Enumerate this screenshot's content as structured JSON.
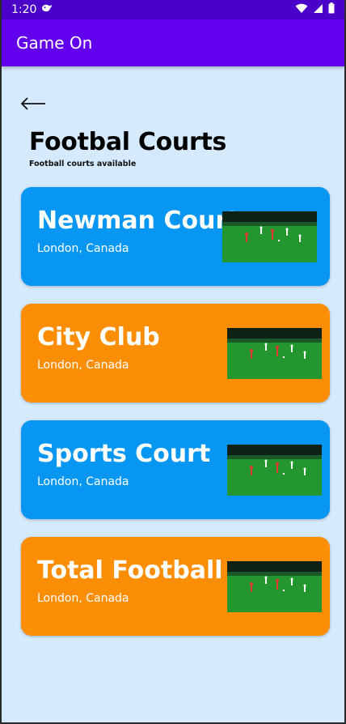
{
  "status_bar": {
    "time": "1:20"
  },
  "app_bar": {
    "title": "Game On"
  },
  "page": {
    "title": "Footbal Courts",
    "subtitle": "Football courts available"
  },
  "colors": {
    "blue": "#0797f2",
    "orange": "#fb8e04",
    "app_bar": "#6200ee",
    "status_bar": "#4a00c8",
    "background": "#d5eafd"
  },
  "courts": [
    {
      "name": "Newman Court",
      "location": "London, Canada",
      "color": "#0797f2"
    },
    {
      "name": "City Club",
      "location": "London, Canada",
      "color": "#fb8e04"
    },
    {
      "name": "Sports Court",
      "location": "London, Canada",
      "color": "#0797f2"
    },
    {
      "name": "Total Football",
      "location": "London, Canada",
      "color": "#fb8e04"
    }
  ]
}
